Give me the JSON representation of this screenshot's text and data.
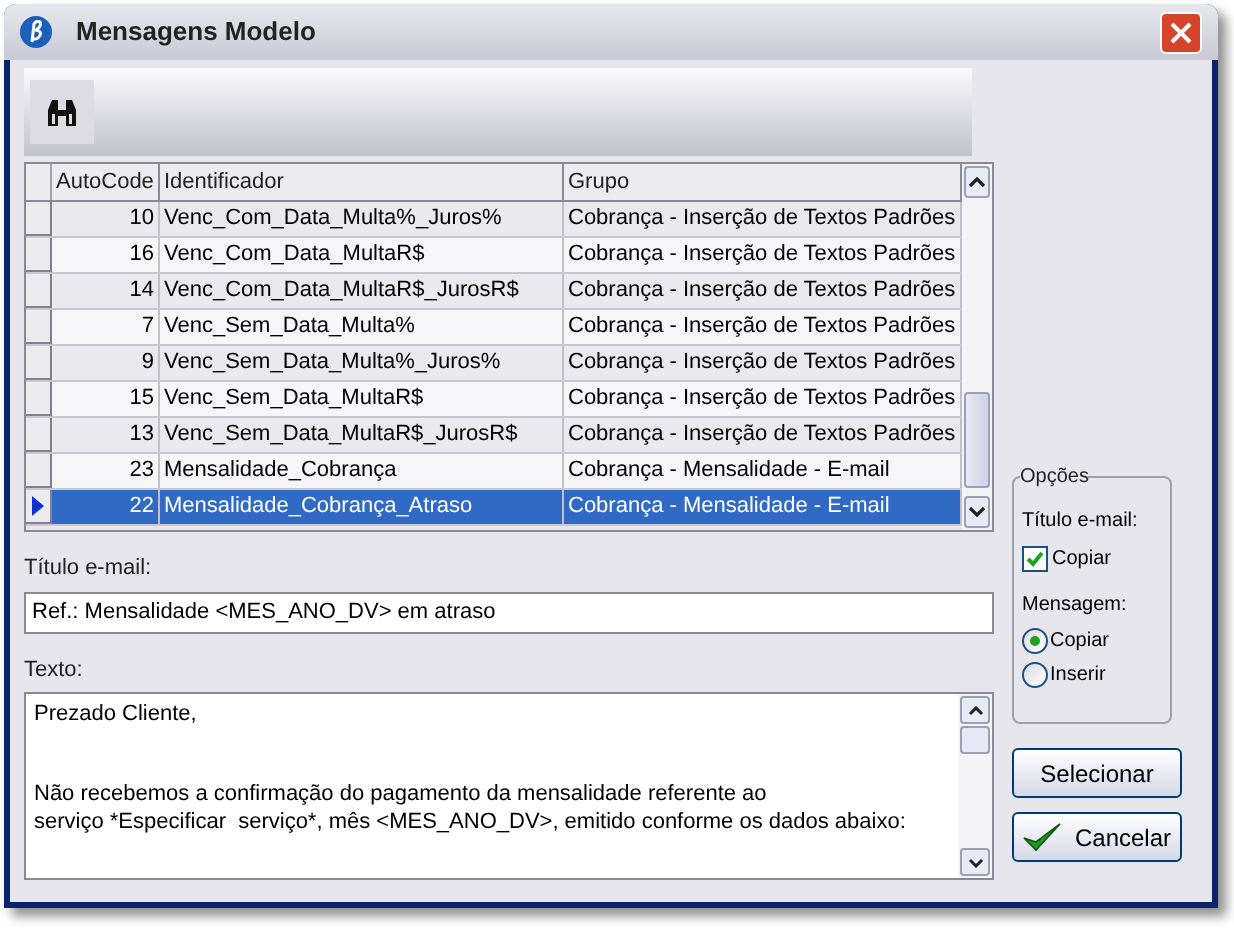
{
  "window": {
    "title": "Mensagens Modelo"
  },
  "table": {
    "columns": [
      "AutoCode",
      "Identificador",
      "Grupo"
    ],
    "rows": [
      {
        "cells": [
          "10",
          "Venc_Com_Data_Multa%_Juros%",
          "Cobrança - Inserção de Textos Padrões"
        ],
        "selected": false
      },
      {
        "cells": [
          "16",
          "Venc_Com_Data_MultaR$",
          "Cobrança - Inserção de Textos Padrões"
        ],
        "selected": false
      },
      {
        "cells": [
          "14",
          "Venc_Com_Data_MultaR$_JurosR$",
          "Cobrança - Inserção de Textos Padrões"
        ],
        "selected": false
      },
      {
        "cells": [
          "7",
          "Venc_Sem_Data_Multa%",
          "Cobrança - Inserção de Textos Padrões"
        ],
        "selected": false
      },
      {
        "cells": [
          "9",
          "Venc_Sem_Data_Multa%_Juros%",
          "Cobrança - Inserção de Textos Padrões"
        ],
        "selected": false
      },
      {
        "cells": [
          "15",
          "Venc_Sem_Data_MultaR$",
          "Cobrança - Inserção de Textos Padrões"
        ],
        "selected": false
      },
      {
        "cells": [
          "13",
          "Venc_Sem_Data_MultaR$_JurosR$",
          "Cobrança - Inserção de Textos Padrões"
        ],
        "selected": false
      },
      {
        "cells": [
          "23",
          "Mensalidade_Cobrança",
          "Cobrança - Mensalidade - E-mail"
        ],
        "selected": false
      },
      {
        "cells": [
          "22",
          "Mensalidade_Cobrança_Atraso",
          "Cobrança - Mensalidade - E-mail"
        ],
        "selected": true
      }
    ]
  },
  "title_field": {
    "label": "Título e-mail:",
    "value": "Ref.: Mensalidade <MES_ANO_DV> em atraso"
  },
  "text_field": {
    "label": "Texto:",
    "paragraphs": [
      "Prezado Cliente,",
      "Não recebemos a confirmação do pagamento da mensalidade referente ao\nserviço *Especificar  serviço*, mês <MES_ANO_DV>, emitido conforme os dados abaixo:"
    ]
  },
  "options": {
    "title": "Opções",
    "title_label": "Título e-mail:",
    "copy_title": {
      "label": "Copiar",
      "checked": true
    },
    "message_label": "Mensagem:",
    "message_modes": [
      {
        "label": "Copiar",
        "selected": true
      },
      {
        "label": "Inserir",
        "selected": false
      }
    ]
  },
  "buttons": [
    {
      "label": "Selecionar",
      "kind": "plain"
    },
    {
      "label": "Cancelar",
      "kind": "check"
    }
  ]
}
